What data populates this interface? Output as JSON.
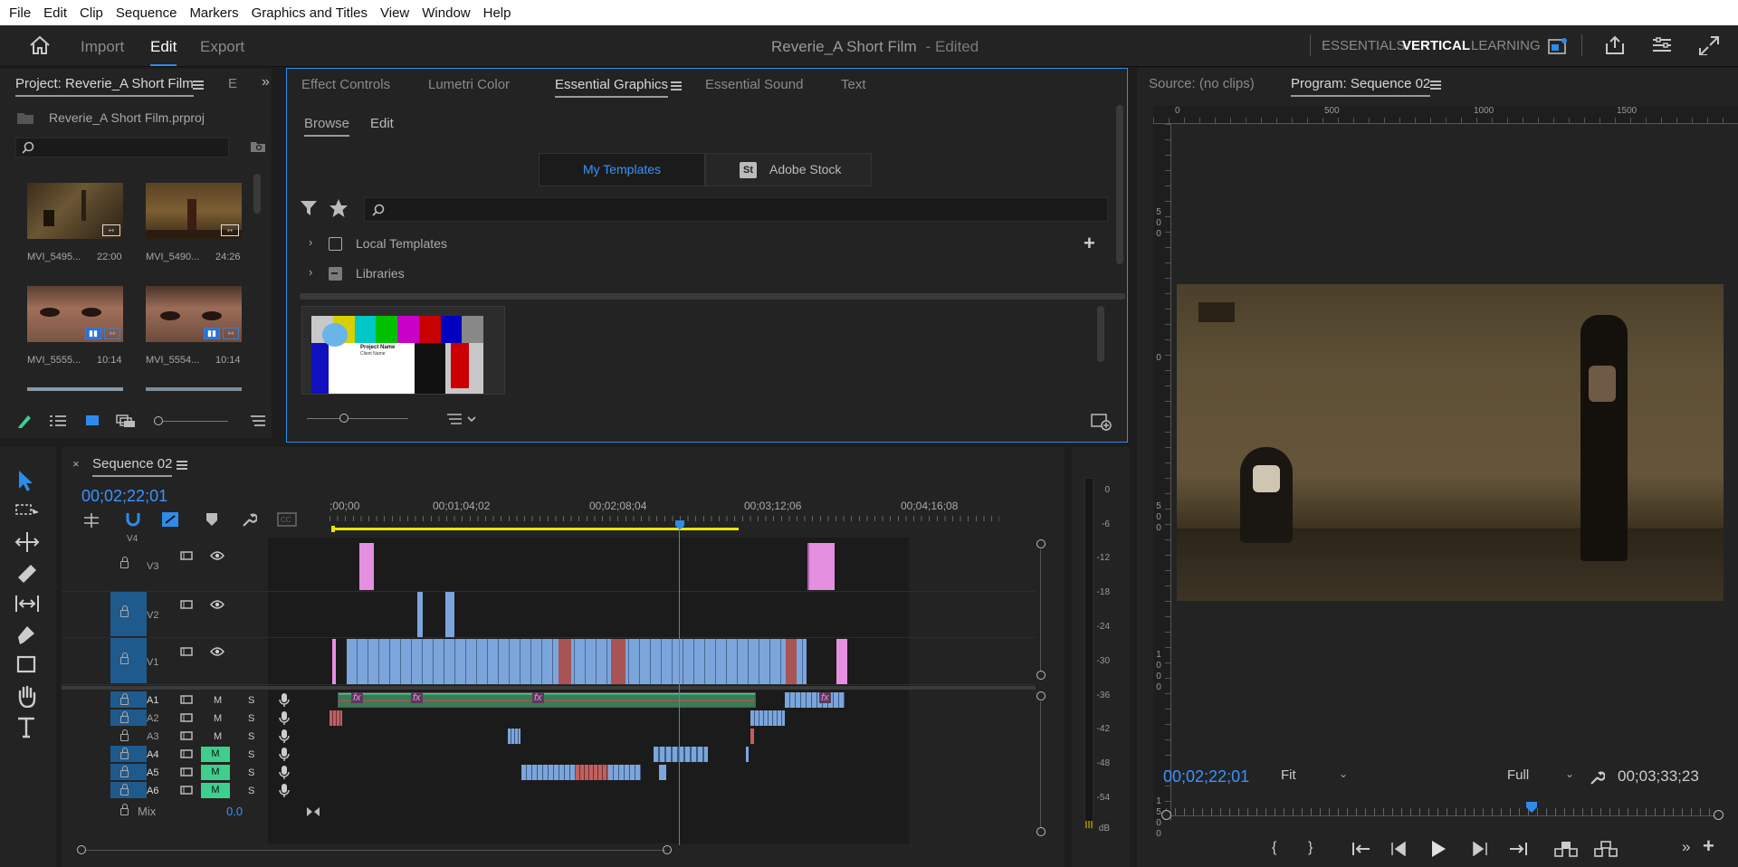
{
  "menu": [
    "File",
    "Edit",
    "Clip",
    "Sequence",
    "Markers",
    "Graphics and Titles",
    "View",
    "Window",
    "Help"
  ],
  "header": {
    "tabs": [
      "Import",
      "Edit",
      "Export"
    ],
    "active_tab": "Edit",
    "project_title": "Reverie_A Short Film",
    "edited_label": "- Edited",
    "workspaces": [
      "ESSENTIALS",
      "VERTICAL",
      "LEARNING"
    ],
    "active_workspace": "VERTICAL"
  },
  "project_panel": {
    "tab_label": "Project: Reverie_A Short Film",
    "extra_tab": "E",
    "file_name": "Reverie_A Short Film.prproj",
    "clips": [
      {
        "name": "MVI_5495...",
        "duration": "22:00"
      },
      {
        "name": "MVI_5490...",
        "duration": "24:26"
      },
      {
        "name": "MVI_5555...",
        "duration": "10:14"
      },
      {
        "name": "MVI_5554...",
        "duration": "10:14"
      }
    ]
  },
  "effects_panel": {
    "tabs": [
      "Effect Controls",
      "Lumetri Color",
      "Essential Graphics",
      "Essential Sound",
      "Text"
    ],
    "active_tab": "Essential Graphics",
    "subtabs": [
      "Browse",
      "Edit"
    ],
    "active_subtab": "Browse",
    "template_buttons": [
      "My Templates",
      "Adobe Stock"
    ],
    "stock_badge": "St",
    "tree_items": [
      "Local Templates",
      "Libraries"
    ],
    "template_card": {
      "project_name": "Project Name",
      "client_name": "Client Name"
    }
  },
  "monitor": {
    "tabs": [
      "Source: (no clips)",
      "Program: Sequence 02"
    ],
    "ruler_ticks": [
      "0",
      "500",
      "1000",
      "1500"
    ],
    "vruler_top": [
      "5",
      "0",
      "0"
    ],
    "vruler_mid": [
      "0"
    ],
    "vruler_low": [
      "5",
      "0",
      "0"
    ],
    "vruler_low2": [
      "1",
      "0",
      "0",
      "0"
    ],
    "vruler_bottom": [
      "1",
      "5",
      "0",
      "0"
    ],
    "timecode": "00;02;22;01",
    "fit_option": "Fit",
    "quality_option": "Full",
    "duration": "00;03;33;23",
    "playhead_fraction": 0.663
  },
  "timeline": {
    "tab_label": "Sequence 02",
    "timecode": "00;02;22;01",
    "ruler": [
      ";00;00",
      "00;01;04;02",
      "00;02;08;04",
      "00;03;12;06",
      "00;04;16;08"
    ],
    "video_tracks": [
      "V4",
      "V3",
      "V2",
      "V1"
    ],
    "audio_tracks": [
      "A1",
      "A2",
      "A3",
      "A4",
      "A5",
      "A6"
    ],
    "track_buttons": {
      "mute": "M",
      "solo": "S"
    },
    "mix_label": "Mix",
    "mix_value": "0.0"
  },
  "meter": {
    "labels": [
      "0",
      "-6",
      "-12",
      "-18",
      "-24",
      "-30",
      "-36",
      "-42",
      "-48",
      "-54",
      "dB"
    ]
  },
  "colors": {
    "accent": "#2d8ceb",
    "video_clip": "#7ca5dc",
    "graphic_clip": "#e48fe0",
    "audio_green": "#3ecf8e",
    "work_area": "#e6e600"
  }
}
